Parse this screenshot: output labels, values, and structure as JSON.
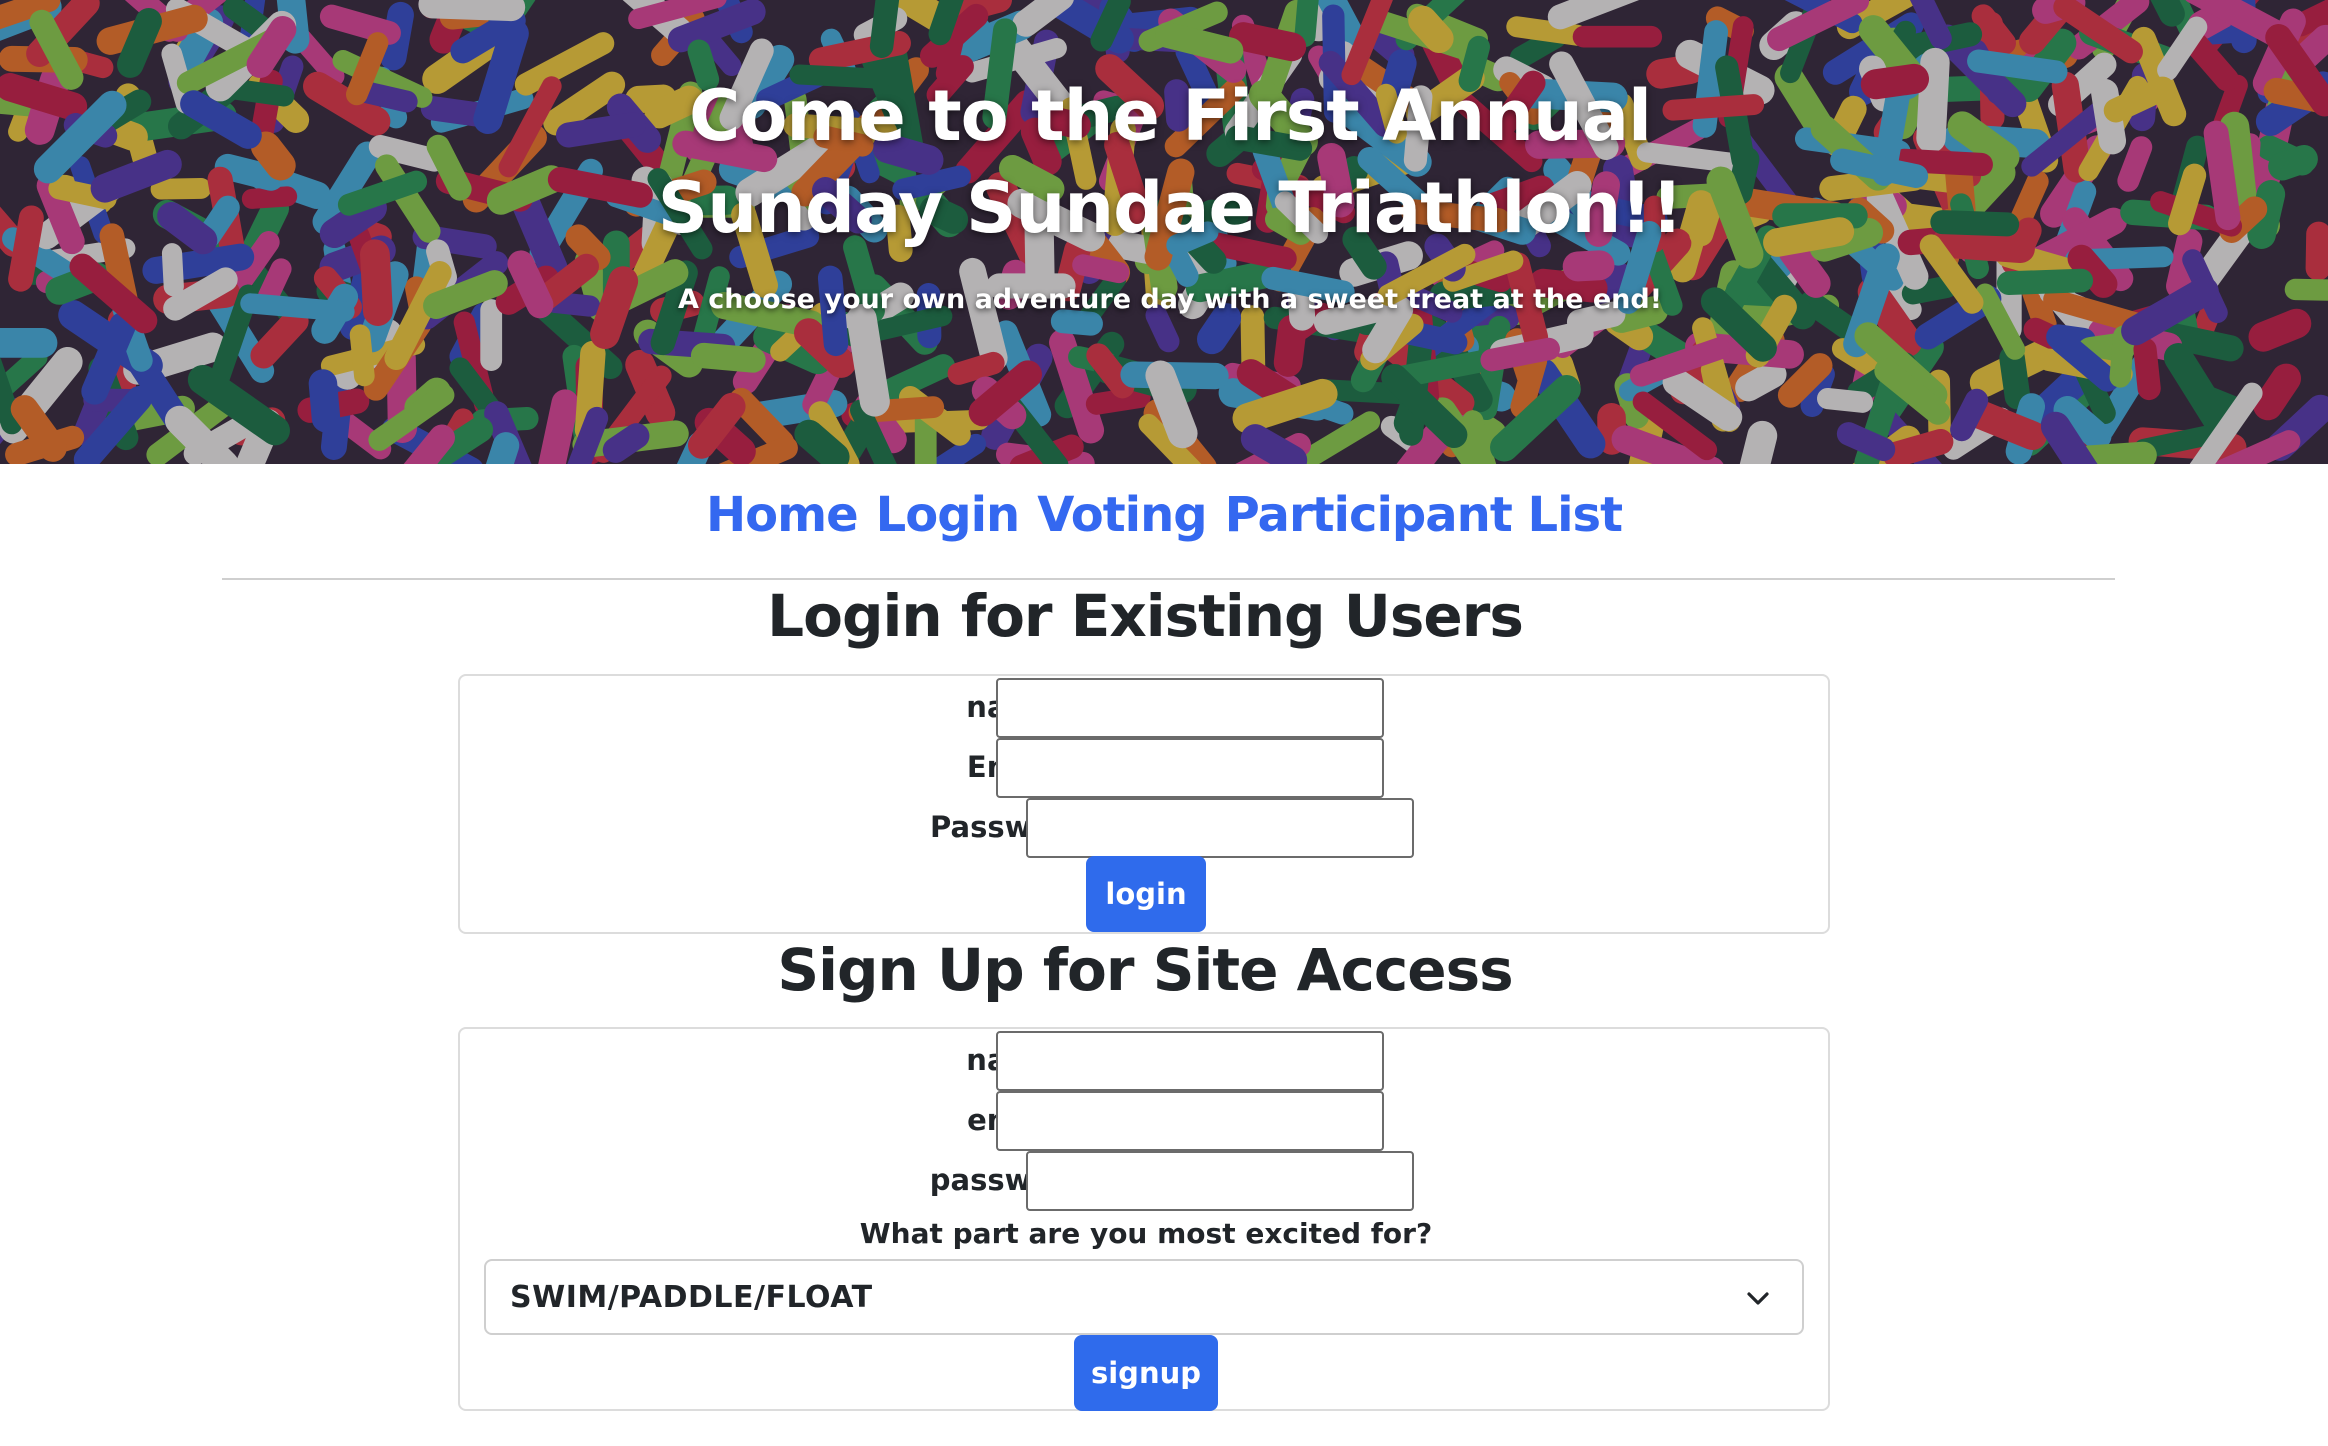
{
  "hero": {
    "title": "Come to the First Annual Sunday Sundae Triathlon!!",
    "subtitle": "A choose your own adventure day with a sweet treat at the end!"
  },
  "nav": {
    "items": [
      "Home",
      "Login",
      "Voting",
      "Participant List"
    ]
  },
  "login": {
    "heading": "Login for Existing Users",
    "name_label": "name:",
    "email_label": "Email:",
    "password_label": "Password:",
    "button_label": "login"
  },
  "signup": {
    "heading": "Sign Up for Site Access",
    "name_label": "name:",
    "email_label": "email:",
    "password_label": "password:",
    "question": "What part are you most excited for?",
    "select_value": "SWIM/PADDLE/FLOAT",
    "button_label": "signup"
  },
  "colors": {
    "accent": "#2f6bec",
    "link": "#3468f0",
    "text": "#212529"
  },
  "icons": {
    "select_arrow": "chevron-down-icon"
  }
}
